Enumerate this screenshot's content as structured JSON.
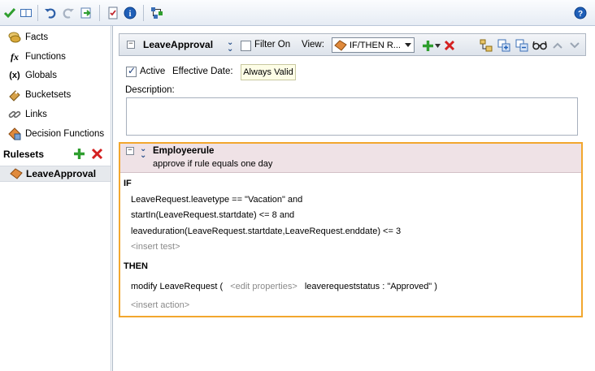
{
  "nav": {
    "items": [
      {
        "label": "Facts",
        "icon": "facts-icon"
      },
      {
        "label": "Functions",
        "icon": "functions-icon",
        "glyph": "fx"
      },
      {
        "label": "Globals",
        "icon": "globals-icon",
        "glyph": "(x)"
      },
      {
        "label": "Bucketsets",
        "icon": "bucketsets-icon"
      },
      {
        "label": "Links",
        "icon": "links-icon"
      },
      {
        "label": "Decision Functions",
        "icon": "decision-functions-icon"
      }
    ],
    "rulesets_label": "Rulesets",
    "selected_ruleset": "LeaveApproval"
  },
  "ruleset": {
    "name": "LeaveApproval",
    "filter_label": "Filter On",
    "view_label": "View:",
    "view_value": "IF/THEN R...",
    "active_label": "Active",
    "effective_label": "Effective Date:",
    "effective_value": "Always Valid",
    "description_label": "Description:"
  },
  "rule": {
    "name": "Employeerule",
    "description": "approve if rule equals one day",
    "if_label": "IF",
    "tests": [
      "LeaveRequest.leavetype  ==  \"Vacation\" and",
      "startIn(LeaveRequest.startdate)  <=  8 and",
      "leaveduration(LeaveRequest.startdate,LeaveRequest.enddate)  <=  3"
    ],
    "insert_test": "<insert test>",
    "then_label": "THEN",
    "action_prefix": "modify LeaveRequest (",
    "edit_properties": "<edit properties>",
    "action_suffix": "leaverequeststatus : \"Approved\"  )",
    "insert_action": "<insert action>"
  },
  "colors": {
    "rule_border": "#f2a72e",
    "rule_header": "#efe2e6",
    "add_green": "#2e9e2e",
    "delete_red": "#d42020"
  }
}
